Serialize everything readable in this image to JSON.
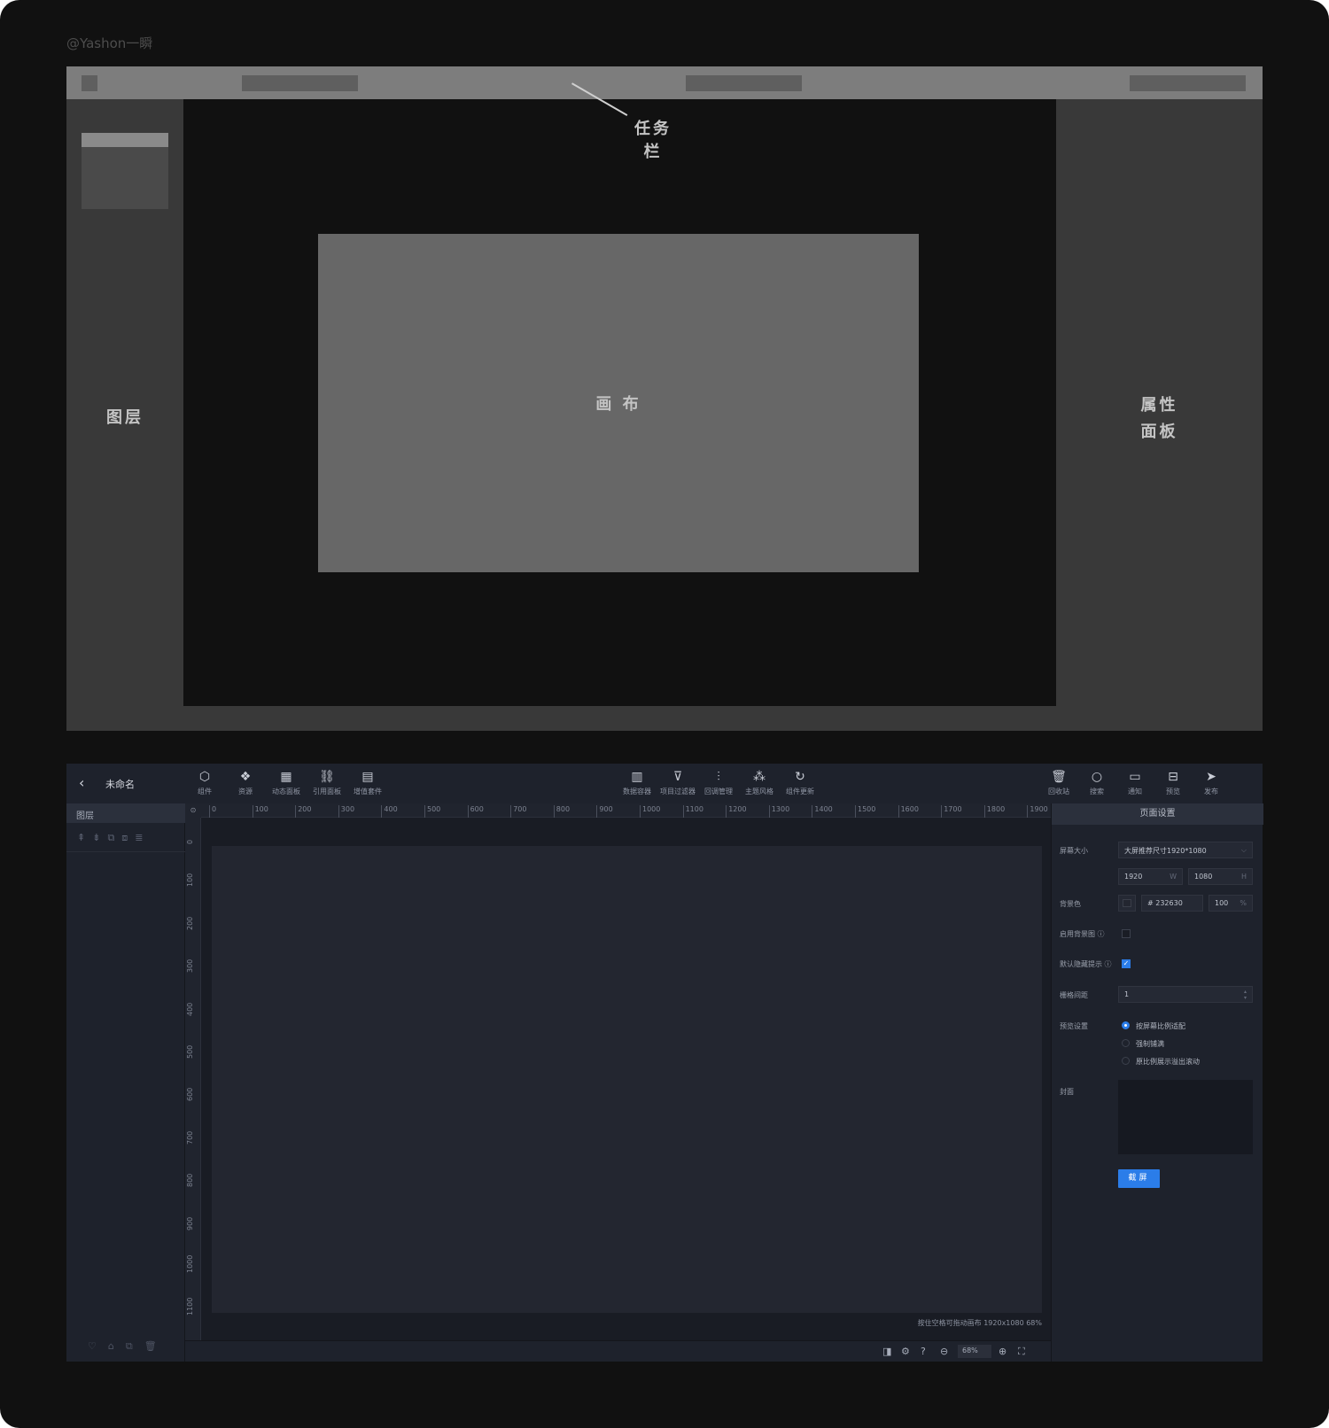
{
  "watermark": "@Yashon一瞬",
  "wireframe": {
    "taskbar_label": "任务栏",
    "layers_label": "图层",
    "canvas_label": "画  布",
    "properties_label_1": "属性",
    "properties_label_2": "面板"
  },
  "editor": {
    "back_icon": "‹",
    "title": "未命名",
    "toolbar_left": [
      {
        "icon": "⬡",
        "label": "组件"
      },
      {
        "icon": "❖",
        "label": "资源"
      },
      {
        "icon": "▦",
        "label": "动态面板"
      },
      {
        "icon": "⛓",
        "label": "引用面板"
      },
      {
        "icon": "▤",
        "label": "增值套件"
      }
    ],
    "toolbar_center": [
      {
        "icon": "▥",
        "label": "数据容器"
      },
      {
        "icon": "⊽",
        "label": "项目过滤器"
      },
      {
        "icon": "⫶",
        "label": "回调管理"
      },
      {
        "icon": "⁂",
        "label": "主题风格"
      },
      {
        "icon": "↻",
        "label": "组件更新"
      }
    ],
    "toolbar_right": [
      {
        "icon": "🗑",
        "label": "回收站"
      },
      {
        "icon": "○",
        "label": "搜索"
      },
      {
        "icon": "▭",
        "label": "通知"
      },
      {
        "icon": "⊟",
        "label": "预览"
      },
      {
        "icon": "➤",
        "label": "发布"
      }
    ],
    "layers": {
      "title": "图层",
      "tools": [
        "⇞",
        "⇟",
        "⧉",
        "⧈",
        "≣"
      ],
      "bottom_tools": [
        "♡",
        "⌂",
        "⧉",
        "🗑"
      ]
    },
    "ruler": {
      "corner": "⊙",
      "h_ticks": [
        "0",
        "100",
        "200",
        "300",
        "400",
        "500",
        "600",
        "700",
        "800",
        "900",
        "1000",
        "1100",
        "1200",
        "1300",
        "1400",
        "1500",
        "1600",
        "1700",
        "1800",
        "1900"
      ],
      "v_ticks": [
        "0",
        "100",
        "200",
        "300",
        "400",
        "500",
        "600",
        "700",
        "800",
        "900",
        "1000",
        "1100"
      ]
    },
    "canvas_hint": "按住空格可拖动画布   1920x1080 68%",
    "zoom": {
      "value": "68%",
      "icons": [
        "◨",
        "⚙",
        "?",
        "⊖",
        "⊕",
        "⛶"
      ]
    },
    "page_settings": {
      "title": "页面设置",
      "screen_size_label": "屏幕大小",
      "screen_size_value": "大屏推荐尺寸1920*1080",
      "width_value": "1920",
      "width_unit": "W",
      "height_value": "1080",
      "height_unit": "H",
      "bg_color_label": "背景色",
      "bg_color_value": "# 232630",
      "bg_opacity_value": "100",
      "bg_opacity_unit": "%",
      "bg_image_label": "启用背景图 ⓘ",
      "hide_hint_label": "默认隐藏提示 ⓘ",
      "grid_label": "栅格间距",
      "grid_value": "1",
      "preview_label": "预览设置",
      "preview_options": [
        "按屏幕比例适配",
        "强制铺满",
        "原比例展示溢出滚动"
      ],
      "cover_label": "封面",
      "capture_button": "截屏"
    }
  }
}
